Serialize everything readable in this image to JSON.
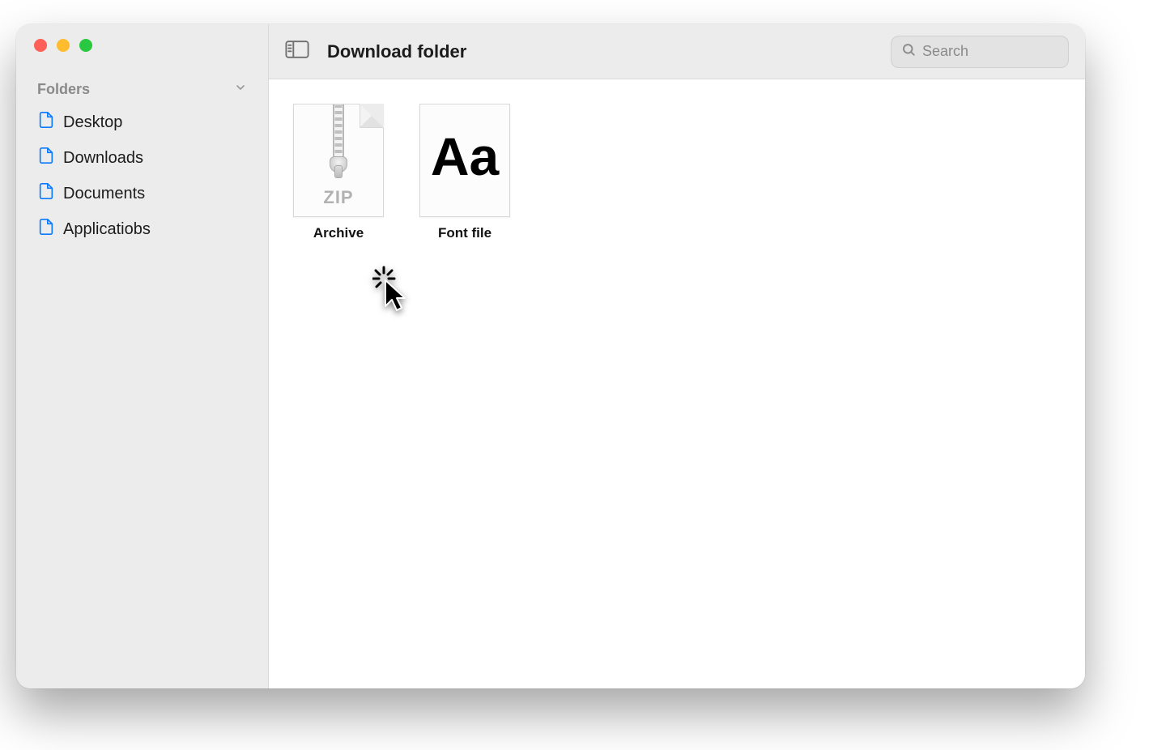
{
  "sidebar": {
    "section_label": "Folders",
    "items": [
      {
        "label": "Desktop"
      },
      {
        "label": "Downloads"
      },
      {
        "label": "Documents"
      },
      {
        "label": "Applicatiobs"
      }
    ]
  },
  "toolbar": {
    "title": "Download folder",
    "search_placeholder": "Search"
  },
  "files": [
    {
      "label": "Archive",
      "type_badge": "ZIP"
    },
    {
      "label": "Font file",
      "glyph": "Aa"
    }
  ]
}
